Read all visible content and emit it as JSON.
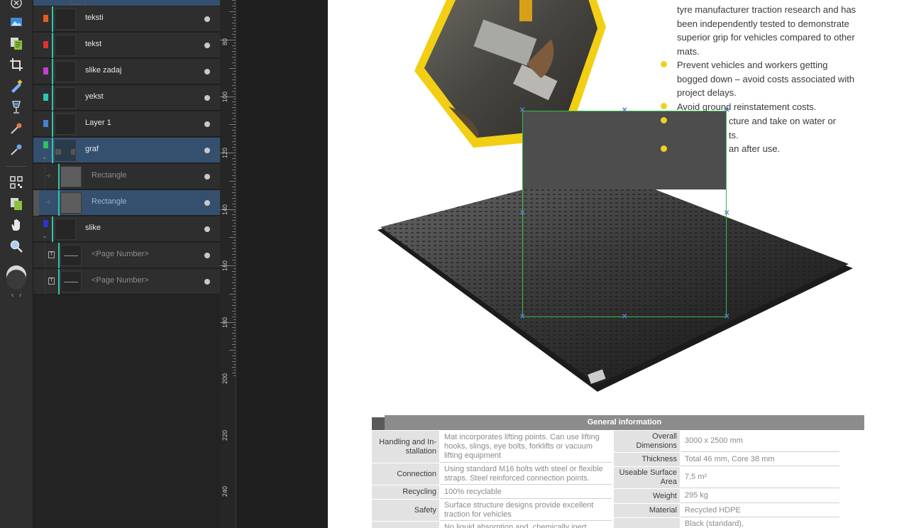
{
  "layers": [
    {
      "name": "teksti",
      "color": "#e85a1f",
      "dim": false
    },
    {
      "name": "tekst",
      "color": "#e23030",
      "dim": false
    },
    {
      "name": "slike zadaj",
      "color": "#c040d0",
      "dim": false
    },
    {
      "name": "yekst",
      "color": "#30c5b0",
      "dim": false
    },
    {
      "name": "Layer 1",
      "color": "#4a7fd0",
      "dim": false
    },
    {
      "name": "graf",
      "color": "#30c060",
      "dim": false
    },
    {
      "name": "Rectangle",
      "color": "",
      "dim": true
    },
    {
      "name": "Rectangle",
      "color": "",
      "dim": true
    },
    {
      "name": "slike",
      "color": "#2b35c8",
      "dim": false
    },
    {
      "name": "<Page Number>",
      "color": "",
      "dim": true
    },
    {
      "name": "<Page Number>",
      "color": "",
      "dim": true
    }
  ],
  "ruler_labels": [
    "80",
    "100",
    "120",
    "140",
    "160",
    "180",
    "200",
    "220",
    "240"
  ],
  "document": {
    "bullets": [
      {
        "lines": [
          "tyre manufacturer traction research and has",
          "been independently tested to demonstrate",
          "superior grip for vehicles compared to other",
          "mats."
        ]
      },
      {
        "lines": [
          "Prevent vehicles and workers getting",
          "bogged down – avoid costs associated with",
          "project delays."
        ]
      },
      {
        "lines": [
          "Avoid ground reinstatement costs."
        ]
      },
      {
        "lines": [
          "cture and take on water or",
          "ts."
        ]
      },
      {
        "lines": [
          "an after use."
        ]
      }
    ],
    "table": {
      "title": "General information",
      "left": [
        {
          "label": "Handling and In-\nstallation",
          "value": "Mat incorporates lifting points. Can use lifting hooks, slings, eye bolts, forklifts or vacuum lifting equipment"
        },
        {
          "label": "Connection",
          "value": "Using standard M16 bolts with steel or flexible straps. Steel reinforced connection points."
        },
        {
          "label": "Recycling",
          "value": "100% recyclable"
        },
        {
          "label": "Safety",
          "value": "Surface structure designs provide excellent traction for vehicles"
        },
        {
          "label": "",
          "value": "No liquid absorption and, chemically inert"
        }
      ],
      "right": [
        {
          "label": "Overall\nDimensions",
          "value": "3000 x 2500 mm"
        },
        {
          "label": "Thickness",
          "value": "Total 46 mm, Core 38 mm"
        },
        {
          "label": "Useable Surface\nArea",
          "value": "7,5 m²"
        },
        {
          "label": "Weight",
          "value": "295 kg"
        },
        {
          "label": "Material",
          "value": "Recycled HDPE"
        },
        {
          "label": "",
          "value": "Black (standard),"
        }
      ]
    }
  },
  "colors": {
    "accent_yellow": "#f0d020",
    "selection_green": "#2fbf4a",
    "layer_line": "#30c5b0"
  }
}
